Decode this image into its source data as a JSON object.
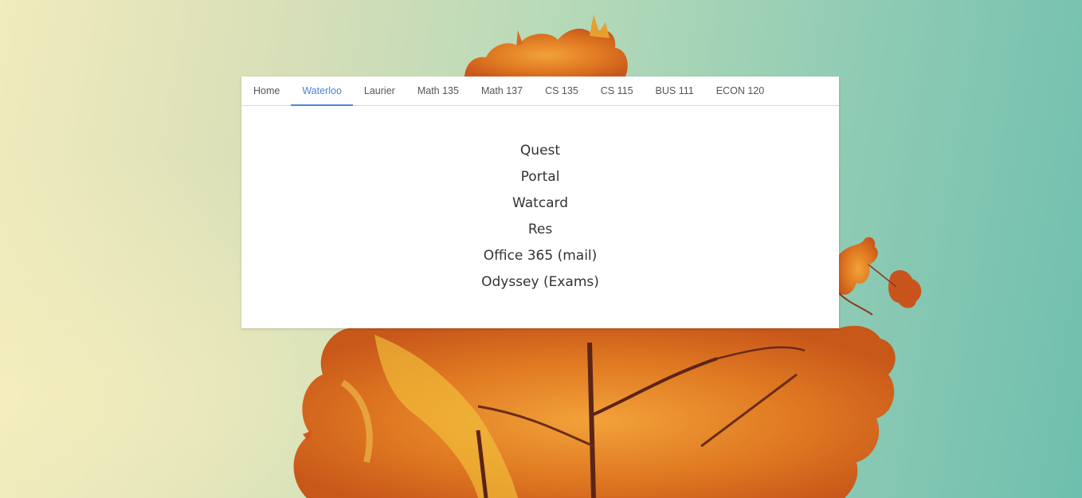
{
  "nav": {
    "tabs": [
      {
        "label": "Home"
      },
      {
        "label": "Waterloo"
      },
      {
        "label": "Laurier"
      },
      {
        "label": "Math 135"
      },
      {
        "label": "Math 137"
      },
      {
        "label": "CS 135"
      },
      {
        "label": "CS 115"
      },
      {
        "label": "BUS 111"
      },
      {
        "label": "ECON 120"
      }
    ],
    "active_tab": "Waterloo"
  },
  "panel": {
    "links": [
      {
        "label": "Quest"
      },
      {
        "label": "Portal"
      },
      {
        "label": "Watcard"
      },
      {
        "label": "Res"
      },
      {
        "label": "Office 365 (mail)"
      },
      {
        "label": "Odyssey (Exams)"
      }
    ]
  },
  "colors": {
    "accent": "#4a86d4",
    "card_bg": "#ffffff",
    "text": "#333333"
  },
  "background": {
    "image": "autumn-maple-tree",
    "gradient": [
      "#f1ebbd",
      "#6fbfae"
    ]
  }
}
